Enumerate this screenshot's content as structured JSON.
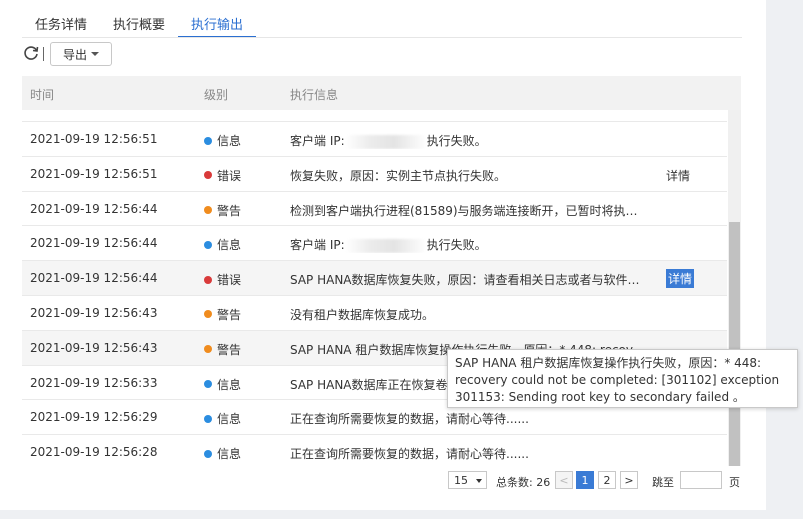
{
  "tabs": [
    {
      "label": "任务详情"
    },
    {
      "label": "执行概要"
    },
    {
      "label": "执行输出"
    }
  ],
  "toolbar": {
    "export_label": "导出"
  },
  "table": {
    "headers": {
      "time": "时间",
      "level": "级别",
      "message": "执行信息"
    },
    "detail_label": "详情",
    "rows": [
      {
        "time": "2021-09-19 12:56:51",
        "level": "信息",
        "level_color": "#2b8de0",
        "message_prefix": "客户端 IP:",
        "message_suffix": "执行失败。",
        "has_detail": false
      },
      {
        "time": "2021-09-19 12:56:51",
        "level": "错误",
        "level_color": "#d93a3a",
        "message": "恢复失败，原因：实例主节点执行失败。",
        "has_detail": true
      },
      {
        "time": "2021-09-19 12:56:44",
        "level": "警告",
        "level_color": "#f08c1e",
        "message": "检测到客户端执行进程(81589)与服务端连接断开，已暂时将执…",
        "has_detail": false
      },
      {
        "time": "2021-09-19 12:56:44",
        "level": "信息",
        "level_color": "#2b8de0",
        "message_prefix": "客户端 IP:",
        "message_suffix": "执行失败。",
        "has_detail": false
      },
      {
        "time": "2021-09-19 12:56:44",
        "level": "错误",
        "level_color": "#d93a3a",
        "message": "SAP HANA数据库恢复失败，原因：请查看相关日志或者与软件…",
        "has_detail": true
      },
      {
        "time": "2021-09-19 12:56:43",
        "level": "警告",
        "level_color": "#f08c1e",
        "message": "没有租户数据库恢复成功。",
        "has_detail": false
      },
      {
        "time": "2021-09-19 12:56:43",
        "level": "警告",
        "level_color": "#f08c1e",
        "message": "SAP HANA 租户数据库恢复操作执行失败，原因：* 448: recov…",
        "has_detail": false
      },
      {
        "time": "2021-09-19 12:56:33",
        "level": "信息",
        "level_color": "#2b8de0",
        "message": "SAP HANA数据库正在恢复卷",
        "has_detail": false
      },
      {
        "time": "2021-09-19 12:56:29",
        "level": "信息",
        "level_color": "#2b8de0",
        "message": "正在查询所需要恢复的数据，请耐心等待......",
        "has_detail": false
      },
      {
        "time": "2021-09-19 12:56:28",
        "level": "信息",
        "level_color": "#2b8de0",
        "message": "正在查询所需要恢复的数据，请耐心等待......",
        "has_detail": false
      }
    ]
  },
  "tooltip": {
    "text": "SAP HANA 租户数据库恢复操作执行失败，原因：* 448: recovery could not be completed: [301102] exception 301153: Sending root key to secondary failed 。"
  },
  "pagination": {
    "page_size": "15",
    "total_label": "总条数:",
    "total": "26",
    "prev": "<",
    "next": ">",
    "pages": [
      "1",
      "2"
    ],
    "current": "1",
    "jump_label": "跳至",
    "page_suffix": "页"
  },
  "colors": {
    "accent": "#2b6fd1",
    "info": "#2b8de0",
    "error": "#d93a3a",
    "warning": "#f08c1e"
  }
}
